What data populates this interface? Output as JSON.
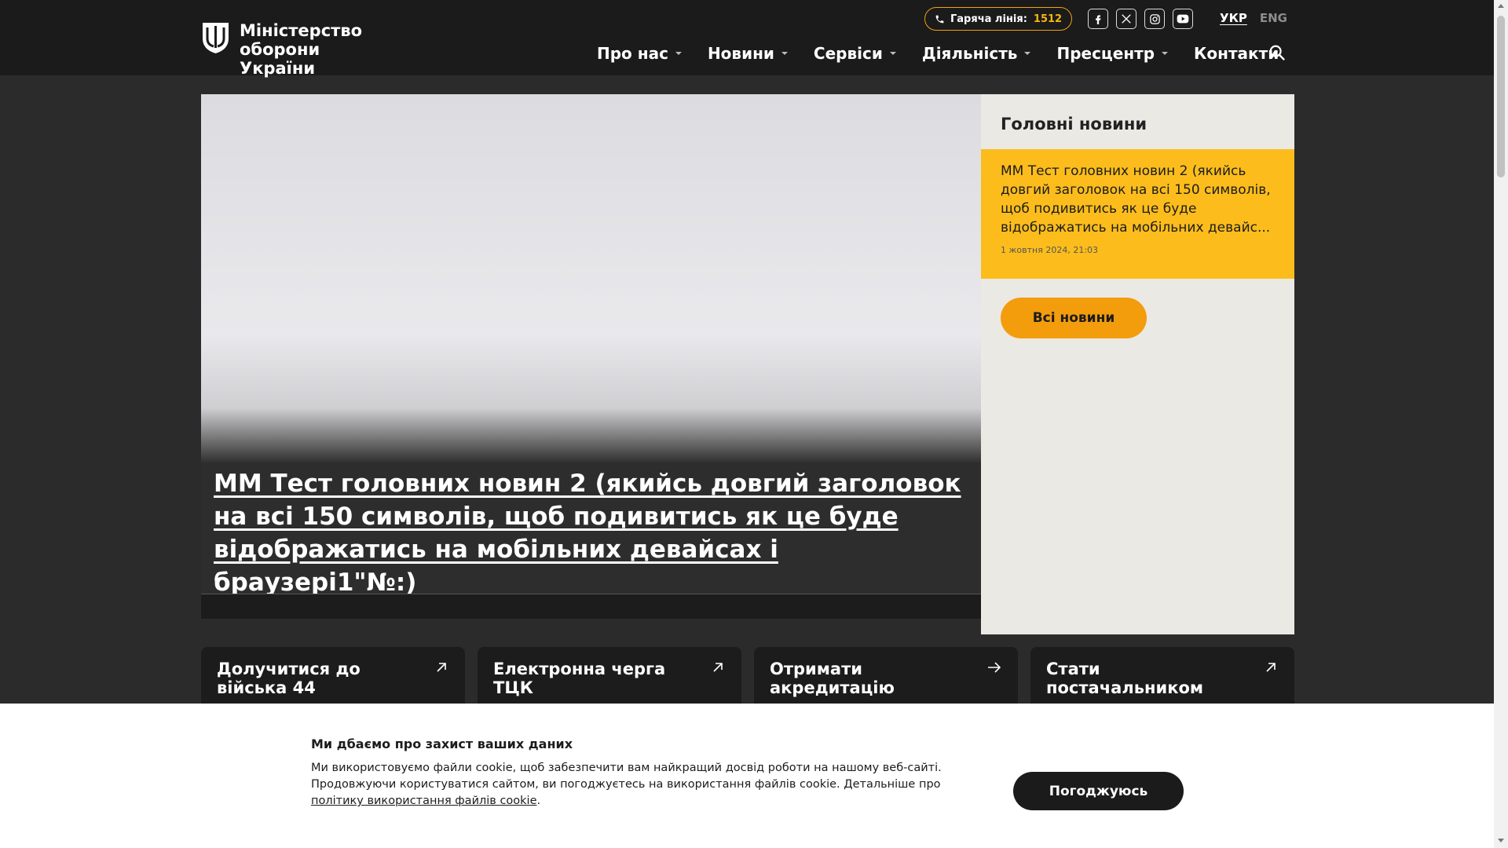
{
  "header": {
    "logo_text": "Міністерство оборони України",
    "hotline_label": "Гаряча лінія:",
    "hotline_number": "1512",
    "socials": [
      "facebook-icon",
      "x-icon",
      "instagram-icon",
      "youtube-icon"
    ],
    "languages": [
      {
        "label": "УКР",
        "active": true
      },
      {
        "label": "ENG",
        "active": false
      }
    ],
    "nav": [
      {
        "label": "Про нас",
        "dropdown": true
      },
      {
        "label": "Новини",
        "dropdown": true
      },
      {
        "label": "Сервіси",
        "dropdown": true
      },
      {
        "label": "Діяльність",
        "dropdown": true
      },
      {
        "label": "Пресцентр",
        "dropdown": true
      },
      {
        "label": "Контакти",
        "dropdown": false
      }
    ]
  },
  "hero": {
    "title": "ММ Тест головних новин 2 (якийсь довгий заголовок на всі 150 символів, щоб подивитись як це буде відображатись на мобільних девайсах і браузері1\"№:)"
  },
  "side_news": {
    "heading": "Головні новини",
    "items": [
      {
        "title": "ММ Тест головних новин 2 (якийсь довгий заголовок на всі 150 символів, щоб подивитись як це буде відображатись на мобільних девайс...",
        "date": "1 жовтня 2024, 21:03"
      }
    ],
    "all_news_label": "Всі новини"
  },
  "service_cards": [
    {
      "label": "Долучитися до війська 44",
      "icon": "arrow-up-right-icon"
    },
    {
      "label": "Електронна черга ТЦК",
      "icon": "arrow-up-right-icon"
    },
    {
      "label": "Отримати акредитацію",
      "icon": "arrow-right-icon"
    },
    {
      "label": "Стати постачальником",
      "icon": "arrow-up-right-icon"
    }
  ],
  "cookie": {
    "title": "Ми дбаємо про захист ваших даних",
    "text": "Ми використовуємо файли cookie, щоб забезпечити вам найкращий досвід роботи на нашому веб-сайті. Продовжуючи користуватися сайтом, ви погоджуєтесь на використання файлів cookie. Детальніше про ",
    "link": "політику використання файлів cookie",
    "text_end": ".",
    "accept_label": "Погоджуюсь"
  },
  "colors": {
    "header_bg": "#1b1b1b",
    "accent_yellow": "#fcbd1c",
    "accent_orange": "#f39c0c",
    "side_bg": "#ebe9e4"
  }
}
